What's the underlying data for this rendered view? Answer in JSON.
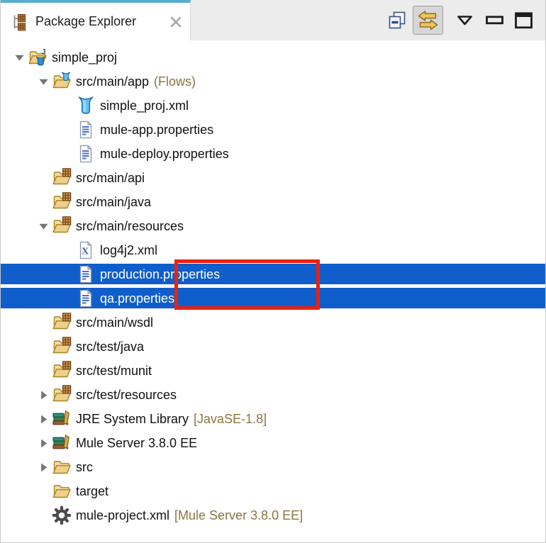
{
  "colors": {
    "selection_background": "#0f5ecb",
    "selection_text": "#ffffff",
    "highlight_red": "#e8220f",
    "decorator_text": "#8c7440",
    "tab_accent_stripe": "#58aecf",
    "header_background": "#ececec",
    "tree_text": "#111111"
  },
  "header": {
    "tab": {
      "title": "Package Explorer",
      "icon": "package-explorer-icon",
      "close_icon": "close-icon"
    },
    "toolbar": {
      "buttons": [
        {
          "id": "collapse-all-button",
          "icon": "collapse-all-icon",
          "pressed": false
        },
        {
          "id": "link-with-editor-button",
          "icon": "link-with-editor-icon",
          "pressed": true
        },
        {
          "id": "view-menu-button",
          "icon": "view-menu-icon",
          "pressed": false
        },
        {
          "id": "minimize-button",
          "icon": "minimize-icon",
          "pressed": false
        },
        {
          "id": "maximize-button",
          "icon": "maximize-icon",
          "pressed": false
        }
      ]
    }
  },
  "tree": {
    "items": [
      {
        "label": "simple_proj",
        "level": 0,
        "icon": "mule-project-icon",
        "arrow": "expanded",
        "selected": false
      },
      {
        "label": "src/main/app",
        "suffix": "(Flows)",
        "level": 1,
        "icon": "flows-folder-icon",
        "arrow": "expanded",
        "selected": false
      },
      {
        "label": "simple_proj.xml",
        "level": 2,
        "icon": "mule-config-icon",
        "arrow": null,
        "selected": false
      },
      {
        "label": "mule-app.properties",
        "level": 2,
        "icon": "properties-file-icon",
        "arrow": null,
        "selected": false
      },
      {
        "label": "mule-deploy.properties",
        "level": 2,
        "icon": "properties-file-icon",
        "arrow": null,
        "selected": false
      },
      {
        "label": "src/main/api",
        "level": 1,
        "icon": "package-folder-icon",
        "arrow": null,
        "selected": false
      },
      {
        "label": "src/main/java",
        "level": 1,
        "icon": "package-folder-icon",
        "arrow": null,
        "selected": false
      },
      {
        "label": "src/main/resources",
        "level": 1,
        "icon": "package-folder-icon",
        "arrow": "expanded",
        "selected": false
      },
      {
        "label": "log4j2.xml",
        "level": 2,
        "icon": "xml-file-icon",
        "arrow": null,
        "selected": false
      },
      {
        "label": "production.properties",
        "level": 2,
        "icon": "properties-file-icon",
        "arrow": null,
        "selected": true
      },
      {
        "label": "qa.properties",
        "level": 2,
        "icon": "properties-file-icon",
        "arrow": null,
        "selected": true
      },
      {
        "label": "src/main/wsdl",
        "level": 1,
        "icon": "package-folder-icon",
        "arrow": null,
        "selected": false
      },
      {
        "label": "src/test/java",
        "level": 1,
        "icon": "package-folder-icon",
        "arrow": null,
        "selected": false
      },
      {
        "label": "src/test/munit",
        "level": 1,
        "icon": "package-folder-icon",
        "arrow": null,
        "selected": false
      },
      {
        "label": "src/test/resources",
        "level": 1,
        "icon": "package-folder-icon",
        "arrow": "collapsed",
        "selected": false
      },
      {
        "label": "JRE System Library",
        "suffix": "[JavaSE-1.8]",
        "level": 1,
        "icon": "library-icon",
        "arrow": "collapsed",
        "selected": false
      },
      {
        "label": "Mule Server 3.8.0 EE",
        "level": 1,
        "icon": "library-icon",
        "arrow": "collapsed",
        "selected": false
      },
      {
        "label": "src",
        "level": 1,
        "icon": "folder-icon",
        "arrow": "collapsed",
        "selected": false
      },
      {
        "label": "target",
        "level": 1,
        "icon": "folder-icon",
        "arrow": null,
        "selected": false
      },
      {
        "label": "mule-project.xml",
        "suffix": "[Mule Server 3.8.0 EE]",
        "level": 1,
        "icon": "gear-icon",
        "arrow": null,
        "selected": false
      }
    ]
  },
  "annotation": {
    "highlight_rectangle": {
      "color": "#e8220f",
      "around": [
        "production.properties",
        "qa.properties"
      ]
    }
  }
}
